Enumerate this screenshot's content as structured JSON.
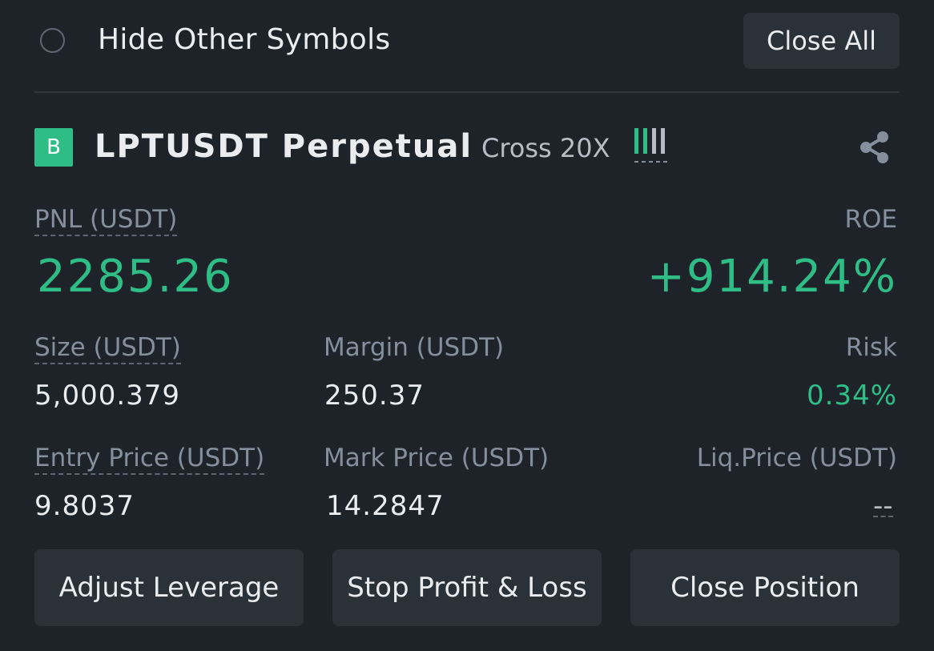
{
  "top": {
    "hide_label": "Hide Other Symbols",
    "close_all_label": "Close All"
  },
  "position": {
    "badge": "B",
    "symbol": "LPTUSDT Perpetual",
    "margin_mode": "Cross 20X",
    "share_icon": "share-icon",
    "leverage_icon": "leverage-bars-icon"
  },
  "pnl": {
    "label": "PNL (USDT)",
    "value": "2285.26"
  },
  "roe": {
    "label": "ROE",
    "value": "+914.24%"
  },
  "size": {
    "label": "Size (USDT)",
    "value": "5,000.379"
  },
  "margin": {
    "label": "Margin (USDT)",
    "value": "250.37"
  },
  "risk": {
    "label": "Risk",
    "value": "0.34%"
  },
  "entry": {
    "label": "Entry Price (USDT)",
    "value": "9.8037"
  },
  "mark": {
    "label": "Mark Price (USDT)",
    "value": "14.2847"
  },
  "liq": {
    "label": "Liq.Price (USDT)",
    "value": "--"
  },
  "actions": {
    "adjust_leverage": "Adjust Leverage",
    "stop_profit_loss": "Stop Profit & Loss",
    "close_position": "Close Position"
  },
  "colors": {
    "background": "#1e2329",
    "positive": "#2ebd85",
    "button": "#2b3139",
    "muted": "#848e9c"
  }
}
